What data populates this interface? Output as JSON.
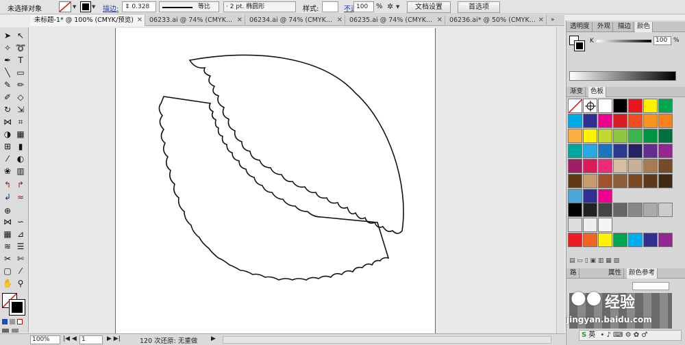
{
  "control_bar": {
    "selection_label": "未选择对象",
    "stroke_label": "描边:",
    "stroke_weight": "0.328",
    "stroke_profile": "等比",
    "brush": "2 pt. 椭圆形",
    "style_label": "样式:",
    "opacity_label": "不透明度:",
    "opacity_value": "100",
    "percent": "%",
    "doc_setup_button": "文档设置",
    "preferences_button": "首选项"
  },
  "document_tabs": [
    {
      "label": "未标题-1* @ 100% (CMYK/预览)",
      "active": true
    },
    {
      "label": "06233.ai @ 74% (CMYK...",
      "active": false
    },
    {
      "label": "06234.ai @ 74% (CMYK...",
      "active": false
    },
    {
      "label": "06235.ai @ 74% (CMYK...",
      "active": false
    },
    {
      "label": "06236.ai* @ 50% (CMYK...",
      "active": false
    }
  ],
  "status_bar": {
    "zoom": "100%",
    "page": "1",
    "status_text": "120 次还原: 无重做"
  },
  "color_panel": {
    "tabs": [
      "透明度",
      "外观",
      "描边",
      "颜色"
    ],
    "channel_label": "K",
    "channel_value": "100",
    "percent": "%"
  },
  "swatches_panel": {
    "tabs": [
      "渐变",
      "色板"
    ],
    "swatch_colors": [
      "none",
      "reg",
      "#ffffff",
      "#000000",
      "#e8161f",
      "#fff200",
      "#00a650",
      "#00a9e8",
      "#2e3192",
      "#ec008c",
      "#d91b23",
      "#f04d23",
      "#f7941d",
      "#f5821f",
      "#fbb040",
      "#fff200",
      "#c1d82f",
      "#8dc63f",
      "#39b54a",
      "#009444",
      "#00713d",
      "#00a79d",
      "#27aae1",
      "#1c75bc",
      "#2b3990",
      "#262262",
      "#652d90",
      "#92278f",
      "#9e1f63",
      "#da1c5c",
      "#ee2a7b",
      "#d7bfa2",
      "#c7b299",
      "#a67c52",
      "#754c29",
      "#603913",
      "#c69c6d",
      "#a0522d",
      "#8b5e3c",
      "#7b4a24",
      "#5c3a1a",
      "#3f2a14",
      "#4aa8d8",
      "#2e3192",
      "#ec008c"
    ],
    "gray_swatches": [
      "#000000",
      "#222222",
      "#444444",
      "#666666",
      "#888888",
      "#aaaaaa",
      "#cccccc",
      "#dddddd",
      "#eeeeee",
      "#f5f5f5"
    ],
    "bottom_row": [
      "#ed1c24",
      "#f26522",
      "#fff200",
      "#00a651",
      "#00aeef",
      "#2e3192",
      "#92278f"
    ]
  },
  "bottom_panel": {
    "tabs": [
      "路",
      "属性",
      "颜色参考"
    ],
    "watermark": "经验",
    "watermark_url": "jingyan.baidu.com",
    "ime": "英"
  }
}
